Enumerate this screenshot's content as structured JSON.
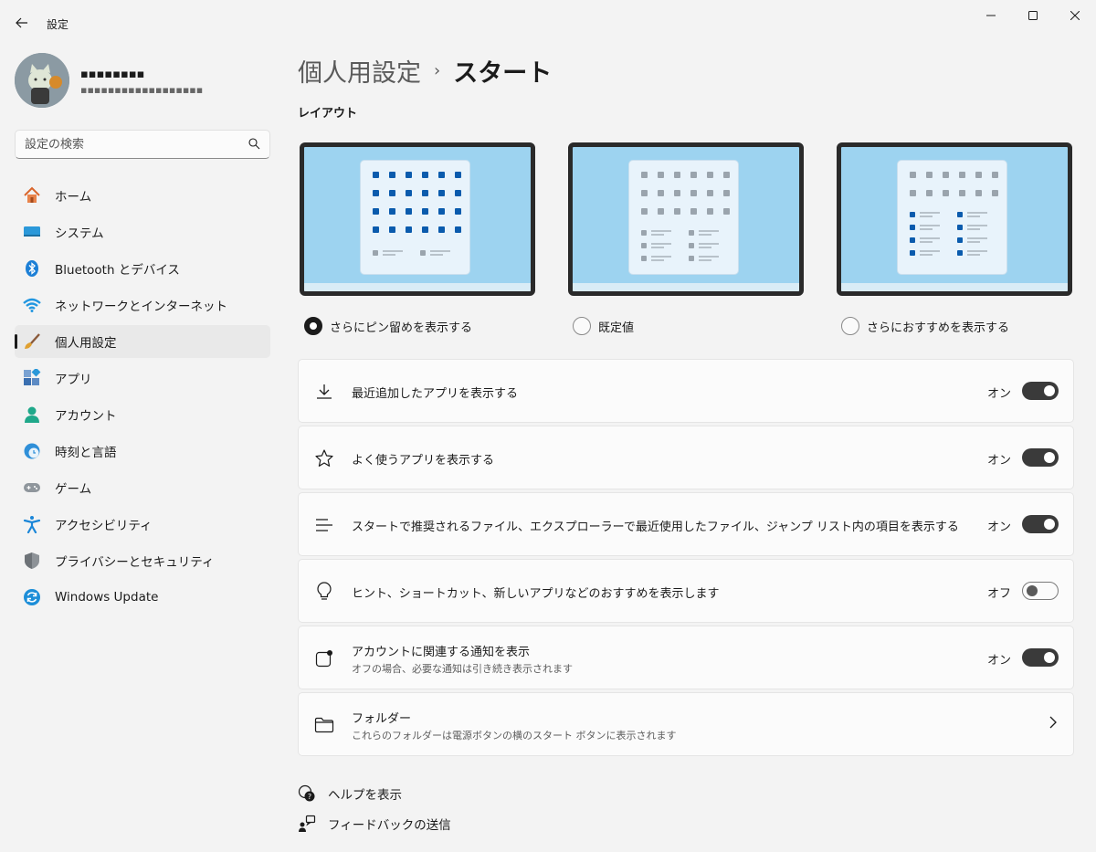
{
  "app": {
    "title": "設定"
  },
  "profile": {
    "name": "▪▪▪▪▪▪▪▪",
    "email": "▪▪▪▪▪▪▪▪▪▪▪▪▪▪▪▪▪▪"
  },
  "search": {
    "placeholder": "設定の検索"
  },
  "sidebar": {
    "items": [
      {
        "label": "ホーム",
        "icon": "home-icon"
      },
      {
        "label": "システム",
        "icon": "system-icon"
      },
      {
        "label": "Bluetooth とデバイス",
        "icon": "bluetooth-icon"
      },
      {
        "label": "ネットワークとインターネット",
        "icon": "wifi-icon"
      },
      {
        "label": "個人用設定",
        "icon": "brush-icon",
        "active": true
      },
      {
        "label": "アプリ",
        "icon": "apps-icon"
      },
      {
        "label": "アカウント",
        "icon": "account-icon"
      },
      {
        "label": "時刻と言語",
        "icon": "clock-globe-icon"
      },
      {
        "label": "ゲーム",
        "icon": "gamepad-icon"
      },
      {
        "label": "アクセシビリティ",
        "icon": "accessibility-icon"
      },
      {
        "label": "プライバシーとセキュリティ",
        "icon": "shield-icon"
      },
      {
        "label": "Windows Update",
        "icon": "update-icon"
      }
    ]
  },
  "header": {
    "parent": "個人用設定",
    "separator": "›",
    "current": "スタート"
  },
  "layout": {
    "title": "レイアウト",
    "options": [
      {
        "label": "さらにピン留めを表示する",
        "selected": true
      },
      {
        "label": "既定値",
        "selected": false
      },
      {
        "label": "さらにおすすめを表示する",
        "selected": false
      }
    ]
  },
  "settings": [
    {
      "title": "最近追加したアプリを表示する",
      "state": "オン",
      "on": true,
      "icon": "download-icon"
    },
    {
      "title": "よく使うアプリを表示する",
      "state": "オン",
      "on": true,
      "icon": "star-icon"
    },
    {
      "title": "スタートで推奨されるファイル、エクスプローラーで最近使用したファイル、ジャンプ リスト内の項目を表示する",
      "state": "オン",
      "on": true,
      "icon": "list-icon"
    },
    {
      "title": "ヒント、ショートカット、新しいアプリなどのおすすめを表示します",
      "state": "オフ",
      "on": false,
      "icon": "lightbulb-icon"
    },
    {
      "title": "アカウントに関連する通知を表示",
      "subtitle": "オフの場合、必要な通知は引き続き表示されます",
      "state": "オン",
      "on": true,
      "icon": "notification-icon"
    }
  ],
  "folders": {
    "title": "フォルダー",
    "subtitle": "これらのフォルダーは電源ボタンの横のスタート ボタンに表示されます"
  },
  "footer": {
    "help": "ヘルプを表示",
    "feedback": "フィードバックの送信"
  },
  "colors": {
    "accent": "#005fb8",
    "toggle_on": "#3a3a3a",
    "thumb_bg": "#9dd3f0"
  }
}
